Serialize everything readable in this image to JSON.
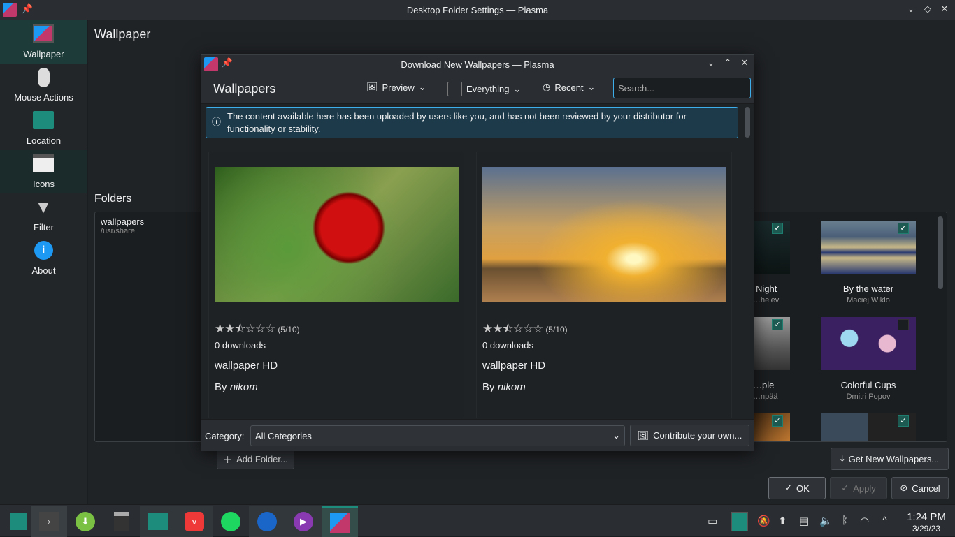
{
  "window": {
    "title": "Desktop Folder Settings — Plasma",
    "controls": [
      "minimize",
      "maximize",
      "close"
    ]
  },
  "sidebar": {
    "items": [
      {
        "label": "Wallpaper",
        "icon": "wallpaper-icon",
        "selected": true
      },
      {
        "label": "Mouse Actions",
        "icon": "mouse-icon"
      },
      {
        "label": "Location",
        "icon": "folder-icon"
      },
      {
        "label": "Icons",
        "icon": "icons-icon"
      },
      {
        "label": "Filter",
        "icon": "filter-icon"
      },
      {
        "label": "About",
        "icon": "info-icon"
      }
    ]
  },
  "main": {
    "title": "Wallpaper",
    "folders_title": "Folders",
    "folder": {
      "name": "wallpapers",
      "path": "/usr/share"
    },
    "wallpapers": [
      {
        "name": "Night",
        "author": "…helev",
        "checked": true
      },
      {
        "name": "By the water",
        "author": "Maciej Wiklo",
        "checked": true
      },
      {
        "name": "…ple",
        "author": "…npää",
        "checked": true
      },
      {
        "name": "Colorful Cups",
        "author": "Dmitri Popov",
        "checked": false
      },
      {
        "name": "",
        "author": "",
        "checked": true
      },
      {
        "name": "",
        "author": "",
        "checked": true
      }
    ],
    "add_folder": "Add Folder...",
    "get_new": "Get New Wallpapers...",
    "ok": "OK",
    "apply": "Apply",
    "cancel": "Cancel"
  },
  "dialog": {
    "title": "Download New Wallpapers — Plasma",
    "heading": "Wallpapers",
    "view": "Preview",
    "filter": "Everything",
    "sort": "Recent",
    "search_placeholder": "Search...",
    "banner": "The content available here has been uploaded by users like you, and has not been reviewed by your distributor for functionality or stability.",
    "items": [
      {
        "rating": "(5/10)",
        "rating_value": 5,
        "downloads": "0 downloads",
        "name": "wallpaper HD",
        "by": "By",
        "author": "nikom"
      },
      {
        "rating": "(5/10)",
        "rating_value": 5,
        "downloads": "0 downloads",
        "name": "wallpaper HD",
        "by": "By",
        "author": "nikom"
      }
    ],
    "category_label": "Category:",
    "category": "All Categories",
    "contribute": "Contribute your own..."
  },
  "taskbar": {
    "time": "1:24 PM",
    "date": "3/29/23",
    "apps": [
      "manjaro-menu",
      "konsole",
      "downloader",
      "calculator",
      "file-manager",
      "vivaldi",
      "spotify",
      "thunderbird",
      "media-player",
      "desktop-settings"
    ]
  },
  "colors": {
    "accent": "#3daee9",
    "selection": "#1d3b39",
    "check": "#1d5a52"
  }
}
